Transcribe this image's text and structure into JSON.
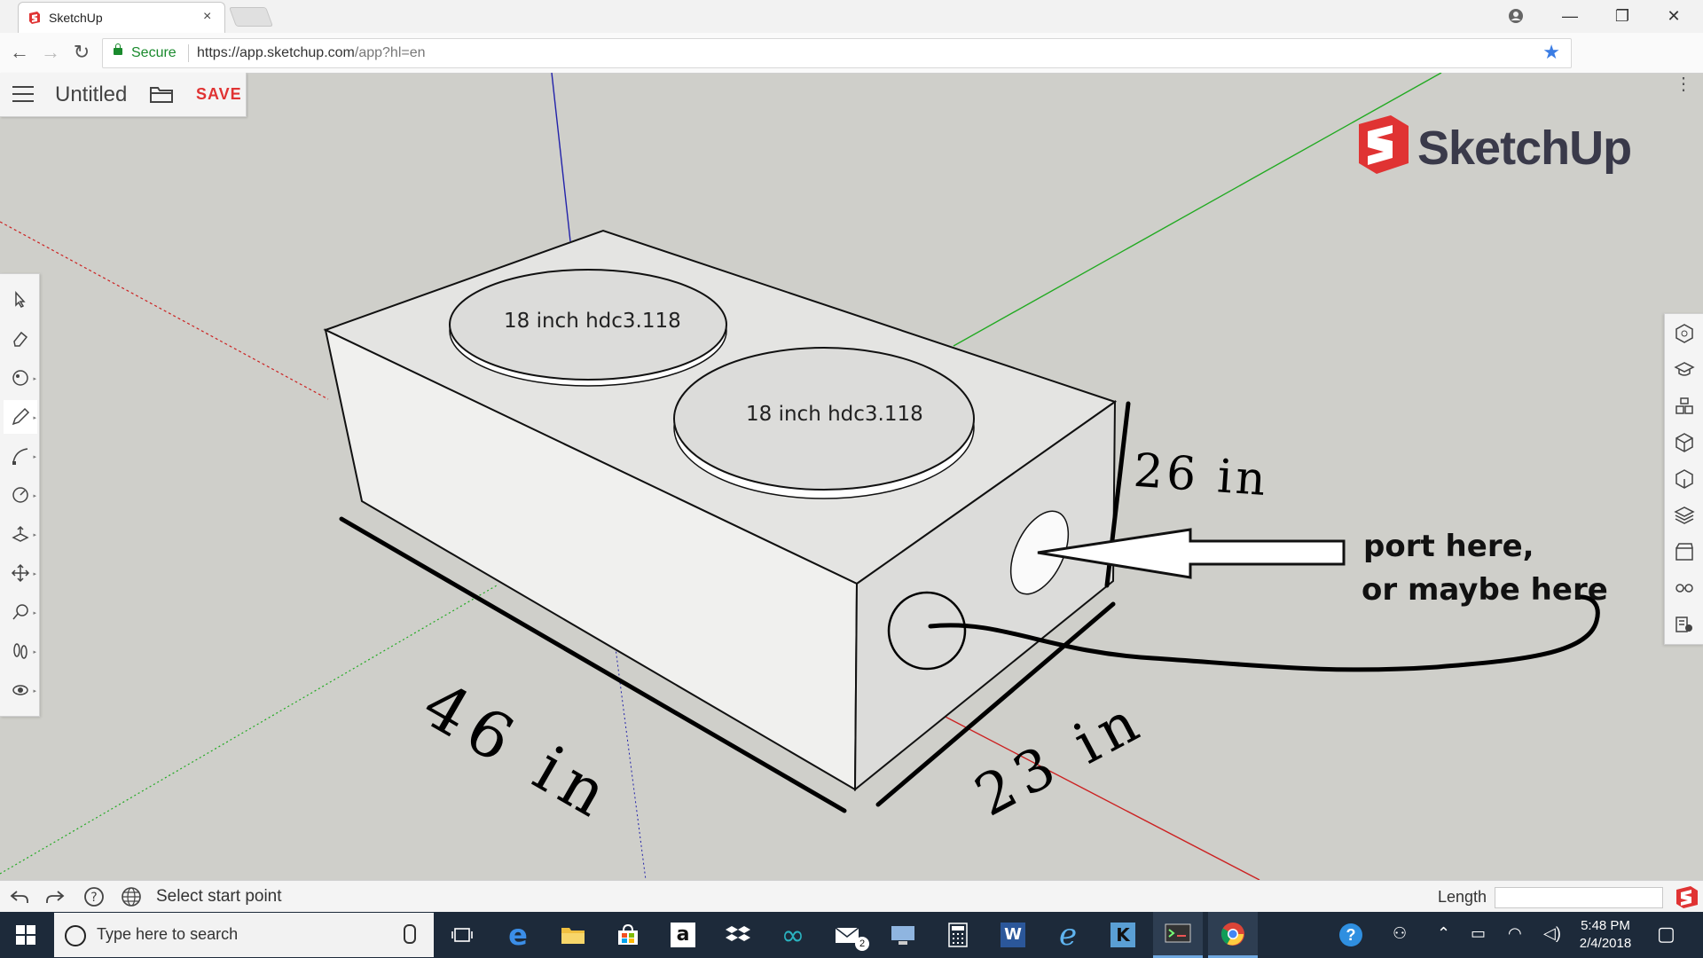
{
  "browser": {
    "tab_title": "SketchUp",
    "tab_close": "×",
    "address": {
      "secure_label": "Secure",
      "url_main": "https://app.sketchup.com",
      "url_path": "/app?hl=en"
    },
    "window_controls": {
      "minimize": "—",
      "restore": "❐",
      "close": "✕"
    }
  },
  "sketchup": {
    "document_title": "Untitled",
    "save_label": "SAVE",
    "logo_text": "SketchUp",
    "status_text": "Select start point",
    "length_label": "Length",
    "length_value": ""
  },
  "model_labels": {
    "speaker_1": "18 inch hdc3.118",
    "speaker_2": "18 inch hdc3.118"
  },
  "annotations": {
    "height": "26 in",
    "length": "46 in",
    "depth": "23 in",
    "note_line1": "port here,",
    "note_line2": "or maybe here"
  },
  "taskbar": {
    "search_placeholder": "Type here to search",
    "mail_badge": "2",
    "time": "5:48 PM",
    "date": "2/4/2018"
  },
  "colors": {
    "accent_red": "#e03333",
    "axis_green": "#22aa22",
    "axis_red": "#cc2222",
    "axis_blue": "#2222aa"
  }
}
